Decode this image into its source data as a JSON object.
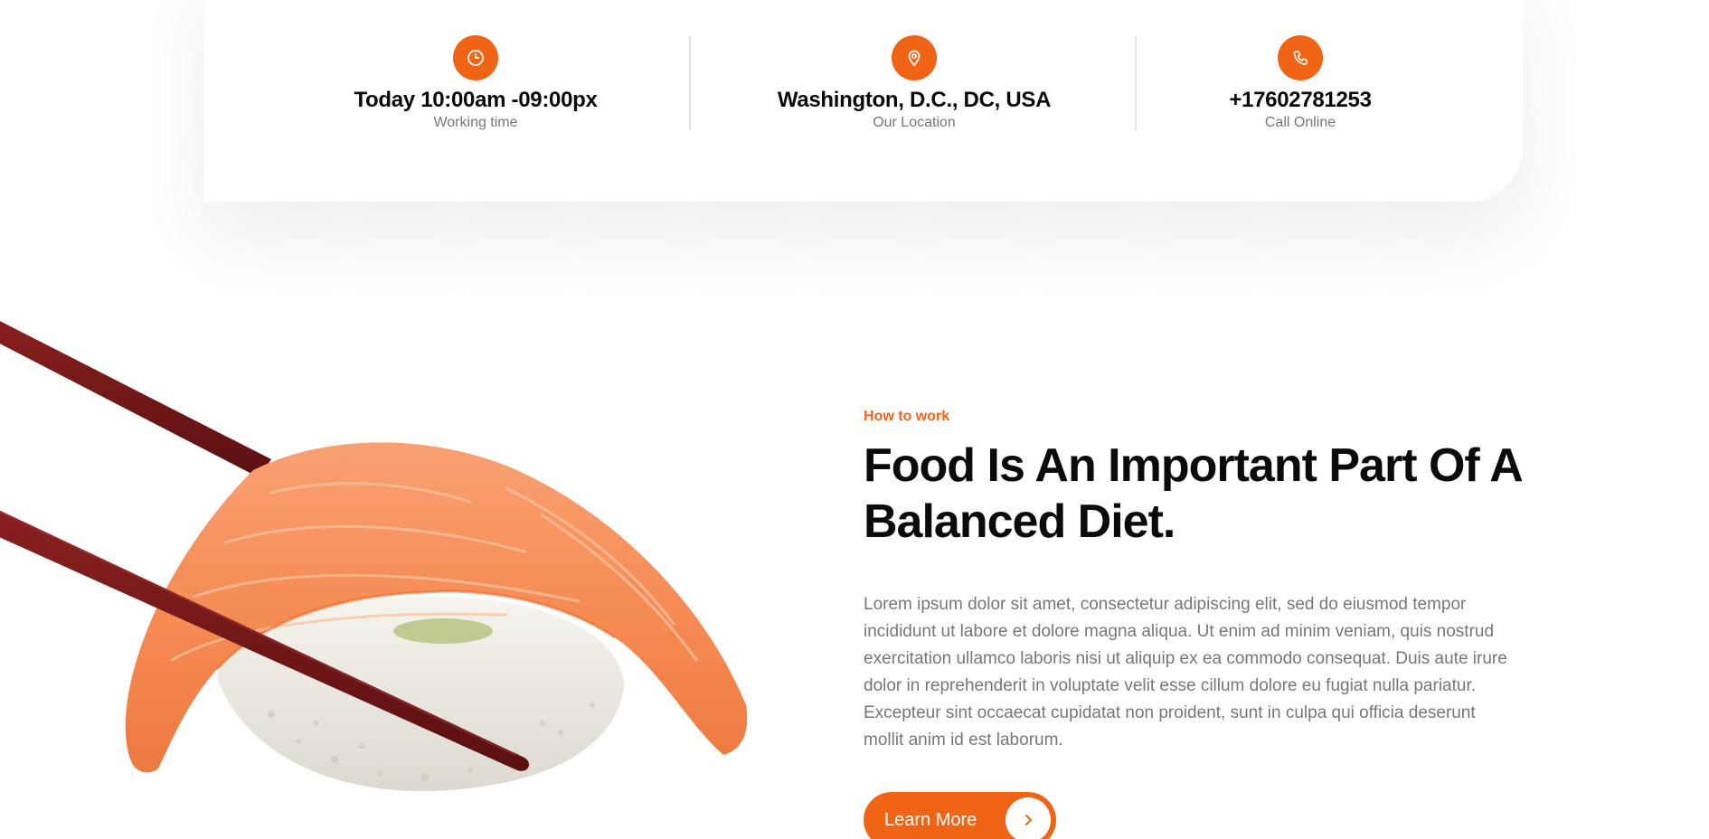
{
  "info_bar": {
    "items": [
      {
        "icon": "clock-icon",
        "value": "Today 10:00am -09:00px",
        "caption": "Working time"
      },
      {
        "icon": "location-pin-icon",
        "value": "Washington, D.C., DC, USA",
        "caption": "Our Location"
      },
      {
        "icon": "phone-icon",
        "value": "+17602781253",
        "caption": "Call Online"
      }
    ]
  },
  "about": {
    "eyebrow": "How to work",
    "headline": "Food Is An Important Part Of A Balanced Diet.",
    "body": "Lorem ipsum dolor sit amet, consectetur adipiscing elit, sed do eiusmod tempor incididunt ut labore et dolore magna aliqua. Ut enim ad minim veniam, quis nostrud exercitation ullamco laboris nisi ut aliquip ex ea commodo consequat. Duis aute irure dolor in reprehenderit in voluptate velit esse cillum dolore eu fugiat nulla pariatur. Excepteur sint occaecat cupidatat non proident, sunt in culpa qui officia deserunt mollit anim id est laborum.",
    "button_label": "Learn More",
    "button_icon": "chevron-right-icon"
  },
  "colors": {
    "accent": "#f06416",
    "heading": "#0b0b0b",
    "muted": "#777777",
    "divider": "#e3e3e3",
    "salmon": "#f58a52",
    "chopstick": "#6e1515"
  }
}
